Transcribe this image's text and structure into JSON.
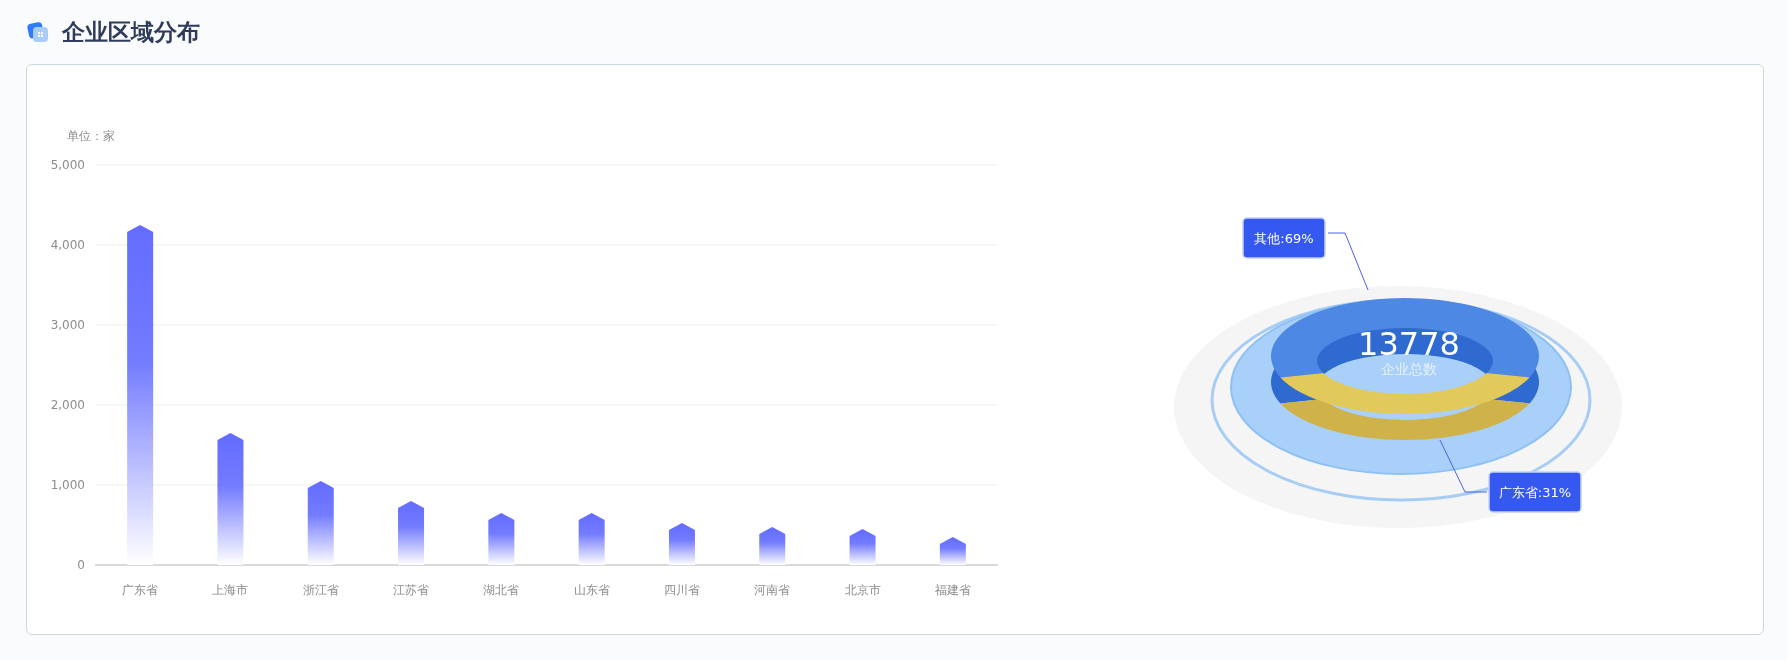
{
  "header": {
    "title": "企业区域分布"
  },
  "bar_chart": {
    "unit": "单位：家",
    "chart_data": {
      "type": "bar",
      "grid": true,
      "categories": [
        "广东省",
        "上海市",
        "浙江省",
        "江苏省",
        "湖北省",
        "山东省",
        "四川省",
        "河南省",
        "北京市",
        "福建省"
      ],
      "values": [
        4250,
        1650,
        1050,
        800,
        650,
        650,
        525,
        475,
        450,
        350
      ],
      "ylim": [
        0,
        5000
      ],
      "yticks": [
        {
          "value": 0,
          "label": "0"
        },
        {
          "value": 1000,
          "label": "1,000"
        },
        {
          "value": 2000,
          "label": "2,000"
        },
        {
          "value": 3000,
          "label": "3,000"
        },
        {
          "value": 4000,
          "label": "4,000"
        },
        {
          "value": 5000,
          "label": "5,000"
        }
      ]
    }
  },
  "donut": {
    "total": "13778",
    "total_label": "企业总数",
    "segments": [
      {
        "label": "其他:69%"
      },
      {
        "label": "广东省:31%"
      }
    ]
  }
}
